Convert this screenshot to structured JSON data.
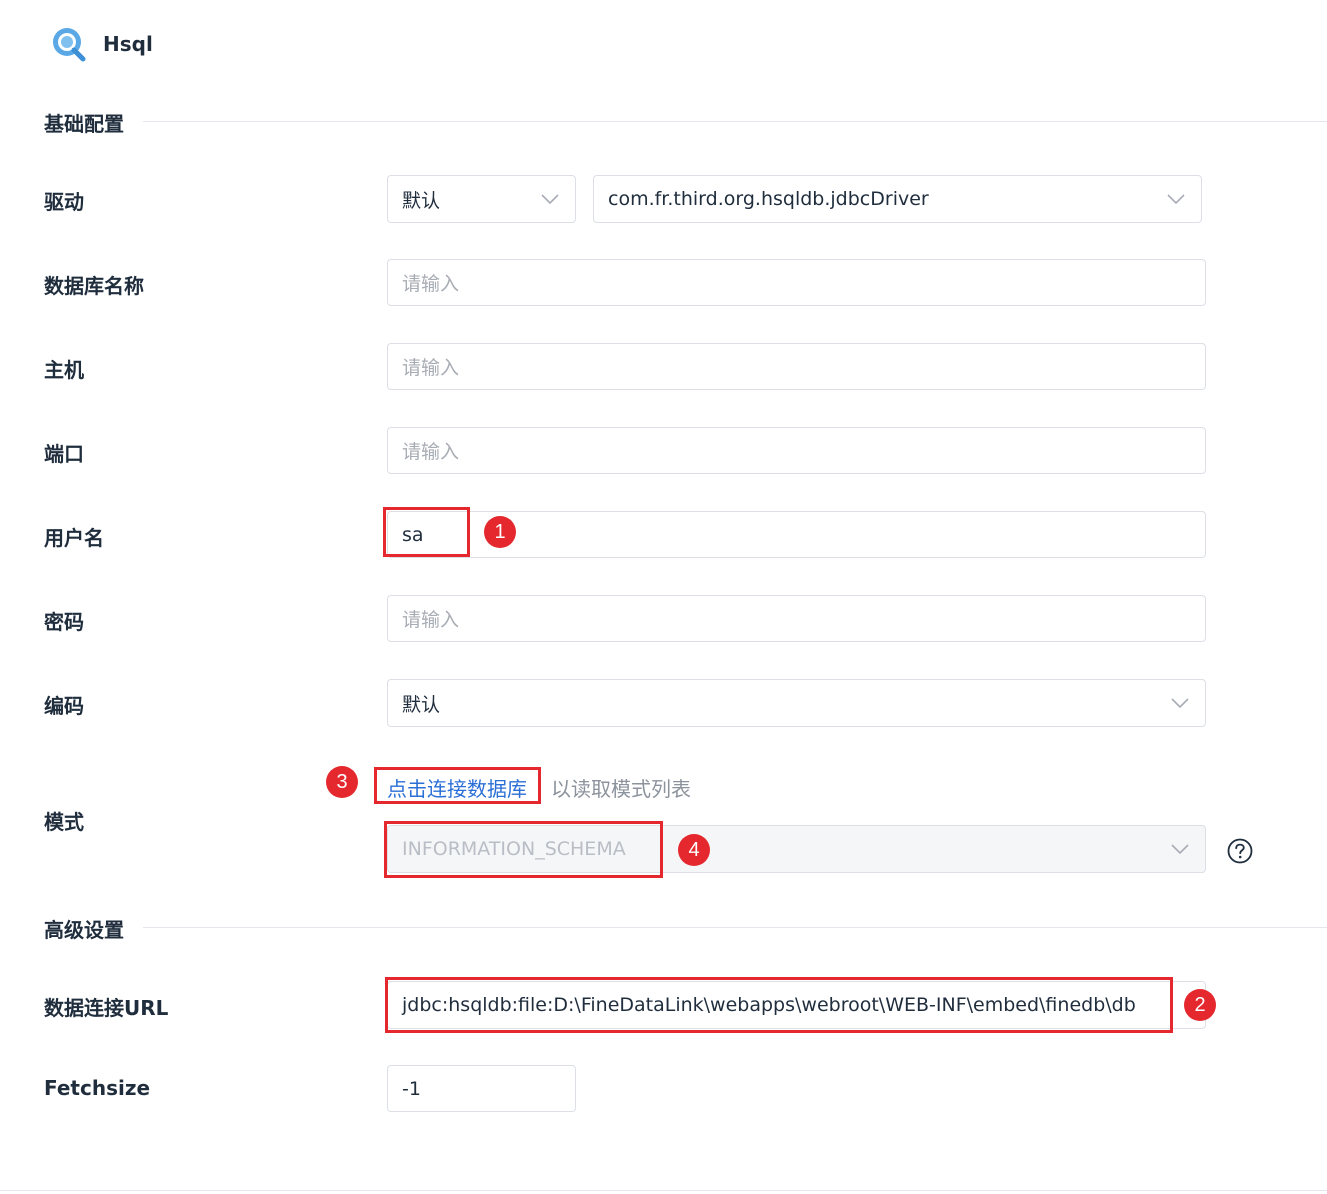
{
  "header": {
    "title": "Hsql",
    "logo_icon": "magnifier-database-icon"
  },
  "sections": {
    "basic": "基础配置",
    "advanced": "高级设置"
  },
  "fields": {
    "driver": {
      "label": "驱动",
      "mode_value": "默认",
      "driver_value": "com.fr.third.org.hsqldb.jdbcDriver"
    },
    "database_name": {
      "label": "数据库名称",
      "placeholder": "请输入"
    },
    "host": {
      "label": "主机",
      "placeholder": "请输入"
    },
    "port": {
      "label": "端口",
      "placeholder": "请输入"
    },
    "username": {
      "label": "用户名",
      "value": "sa"
    },
    "password": {
      "label": "密码",
      "placeholder": "请输入"
    },
    "encoding": {
      "label": "编码",
      "value": "默认"
    },
    "schema": {
      "label": "模式",
      "connect_link": "点击连接数据库",
      "connect_hint": "以读取模式列表",
      "value": "INFORMATION_SCHEMA"
    },
    "url": {
      "label": "数据连接URL",
      "value": "jdbc:hsqldb:file:D:\\FineDataLink\\webapps\\webroot\\WEB-INF\\embed\\finedb\\db"
    },
    "fetchsize": {
      "label": "Fetchsize",
      "value": "-1"
    }
  },
  "annotations": {
    "step1": "1",
    "step2": "2",
    "step3": "3",
    "step4": "4"
  },
  "colors": {
    "annotation_red": "#e4282e",
    "link_blue": "#2b6fd6",
    "placeholder_gray": "#a8adb5"
  }
}
